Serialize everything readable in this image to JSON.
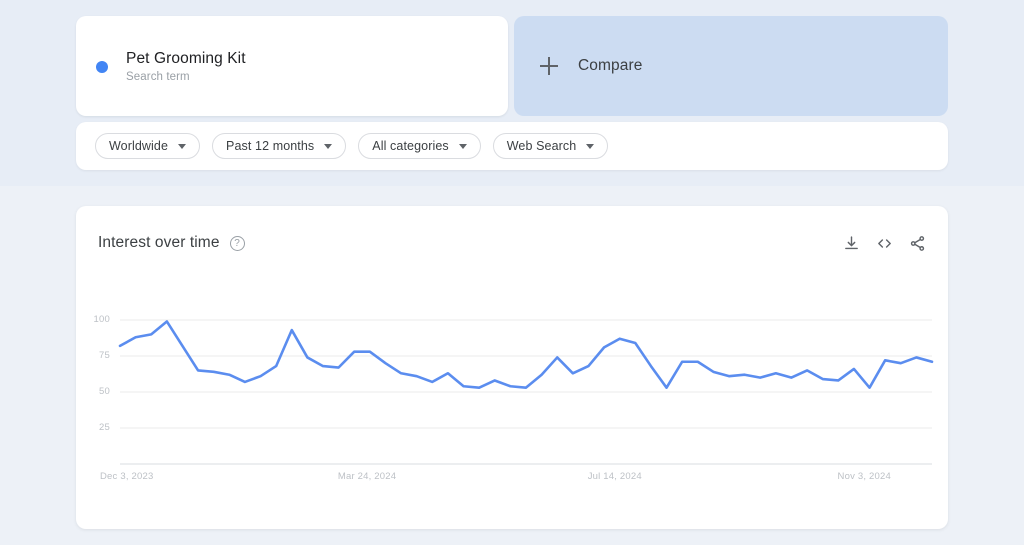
{
  "search_term": {
    "name": "Pet Grooming Kit",
    "type_label": "Search term",
    "dot_color": "#4285f4"
  },
  "compare": {
    "label": "Compare",
    "icon": "plus-icon"
  },
  "filters": [
    {
      "label": "Worldwide"
    },
    {
      "label": "Past 12 months"
    },
    {
      "label": "All categories"
    },
    {
      "label": "Web Search"
    }
  ],
  "chart_panel": {
    "title": "Interest over time",
    "help_icon": "question-mark-icon",
    "actions": [
      {
        "name": "download-icon"
      },
      {
        "name": "embed-code-icon"
      },
      {
        "name": "share-icon"
      }
    ]
  },
  "chart_data": {
    "type": "line",
    "title": "Interest over time",
    "xlabel": "",
    "ylabel": "",
    "ylim": [
      0,
      105
    ],
    "yticks": [
      100,
      75,
      50,
      25
    ],
    "grid": true,
    "legend": false,
    "line_color": "#5b8def",
    "xticks": [
      "Dec 3, 2023",
      "Mar 24, 2024",
      "Jul 14, 2024",
      "Nov 3, 2024"
    ],
    "xtick_positions": [
      0,
      16,
      32,
      48
    ],
    "x": [
      "Dec 3, 2023",
      "Dec 10, 2023",
      "Dec 17, 2023",
      "Dec 24, 2023",
      "Dec 31, 2023",
      "Jan 7, 2024",
      "Jan 14, 2024",
      "Jan 21, 2024",
      "Jan 28, 2024",
      "Feb 4, 2024",
      "Feb 11, 2024",
      "Feb 18, 2024",
      "Feb 25, 2024",
      "Mar 3, 2024",
      "Mar 10, 2024",
      "Mar 17, 2024",
      "Mar 24, 2024",
      "Mar 31, 2024",
      "Apr 7, 2024",
      "Apr 14, 2024",
      "Apr 21, 2024",
      "Apr 28, 2024",
      "May 5, 2024",
      "May 12, 2024",
      "May 19, 2024",
      "May 26, 2024",
      "Jun 2, 2024",
      "Jun 9, 2024",
      "Jun 16, 2024",
      "Jun 23, 2024",
      "Jun 30, 2024",
      "Jul 7, 2024",
      "Jul 14, 2024",
      "Jul 21, 2024",
      "Jul 28, 2024",
      "Aug 4, 2024",
      "Aug 11, 2024",
      "Aug 18, 2024",
      "Aug 25, 2024",
      "Sep 1, 2024",
      "Sep 8, 2024",
      "Sep 15, 2024",
      "Sep 22, 2024",
      "Sep 29, 2024",
      "Oct 6, 2024",
      "Oct 13, 2024",
      "Oct 20, 2024",
      "Oct 27, 2024",
      "Nov 3, 2024",
      "Nov 10, 2024",
      "Nov 17, 2024",
      "Nov 24, 2024",
      "Dec 1, 2024"
    ],
    "values": [
      82,
      88,
      90,
      99,
      82,
      65,
      64,
      62,
      57,
      61,
      68,
      93,
      74,
      68,
      67,
      78,
      78,
      70,
      63,
      61,
      57,
      63,
      54,
      53,
      58,
      54,
      53,
      62,
      74,
      63,
      68,
      81,
      87,
      84,
      68,
      53,
      71,
      71,
      64,
      61,
      62,
      60,
      63,
      60,
      65,
      59,
      58,
      66,
      53,
      72,
      70,
      74,
      71
    ]
  }
}
